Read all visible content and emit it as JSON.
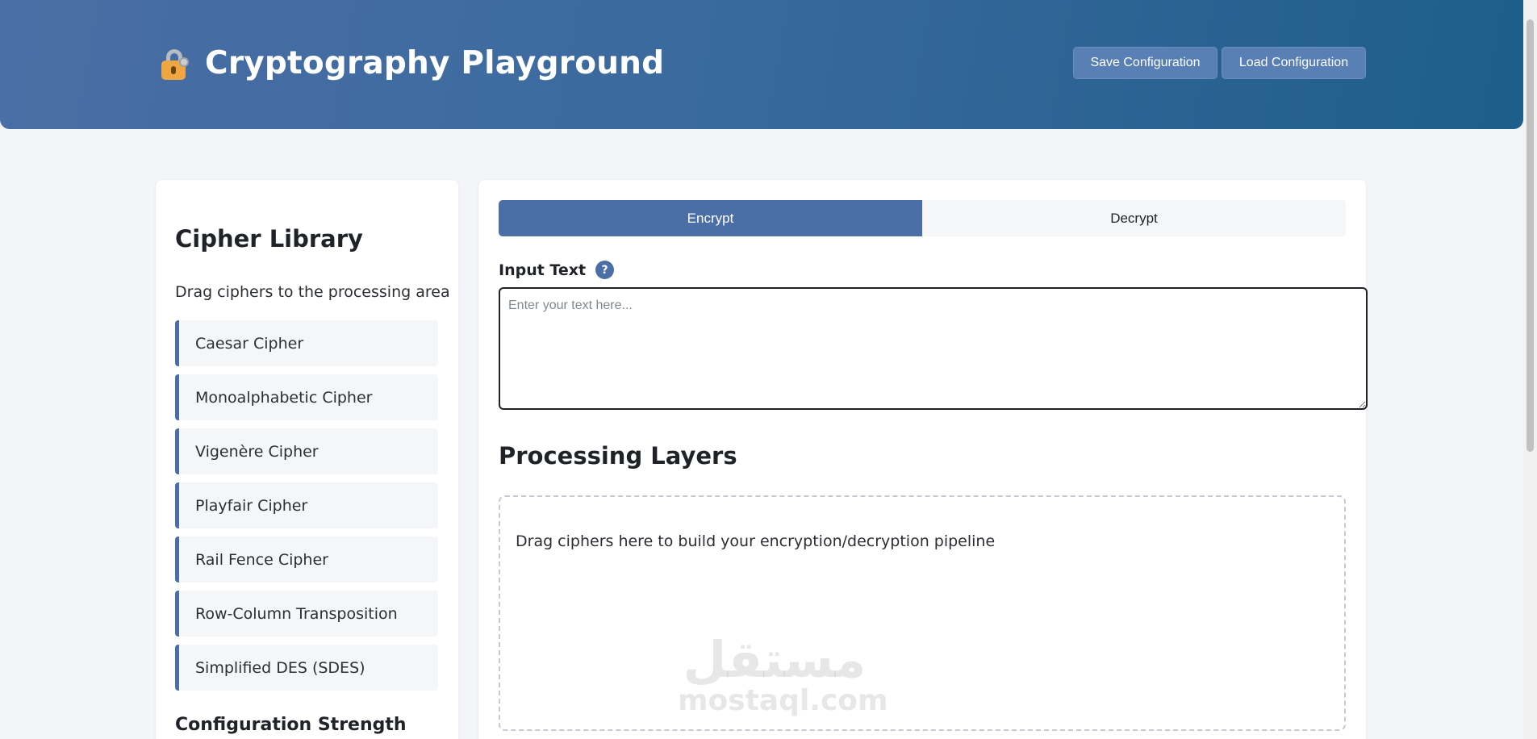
{
  "header": {
    "title": "Cryptography Playground",
    "icon": "lock-with-key-icon",
    "save_label": "Save Configuration",
    "load_label": "Load Configuration"
  },
  "sidebar": {
    "title": "Cipher Library",
    "hint": "Drag ciphers to the processing area",
    "items": [
      {
        "label": "Caesar Cipher"
      },
      {
        "label": "Monoalphabetic Cipher"
      },
      {
        "label": "Vigenère Cipher"
      },
      {
        "label": "Playfair Cipher"
      },
      {
        "label": "Rail Fence Cipher"
      },
      {
        "label": "Row-Column Transposition"
      },
      {
        "label": "Simplified DES (SDES)"
      }
    ],
    "strength_title": "Configuration Strength"
  },
  "main": {
    "tabs": [
      {
        "label": "Encrypt",
        "active": true
      },
      {
        "label": "Decrypt",
        "active": false
      }
    ],
    "input_label": "Input Text",
    "help_glyph": "?",
    "input_placeholder": "Enter your text here...",
    "input_value": "",
    "layers_title": "Processing Layers",
    "dropzone_text": "Drag ciphers here to build your encryption/decryption pipeline"
  },
  "watermark": {
    "arabic": "مستقل",
    "latin": "mostaql.com"
  },
  "colors": {
    "accent": "#4a6ea5",
    "header_start": "#4a6ea5",
    "header_end": "#1e5e8a",
    "page_bg": "#f3f5f8"
  }
}
